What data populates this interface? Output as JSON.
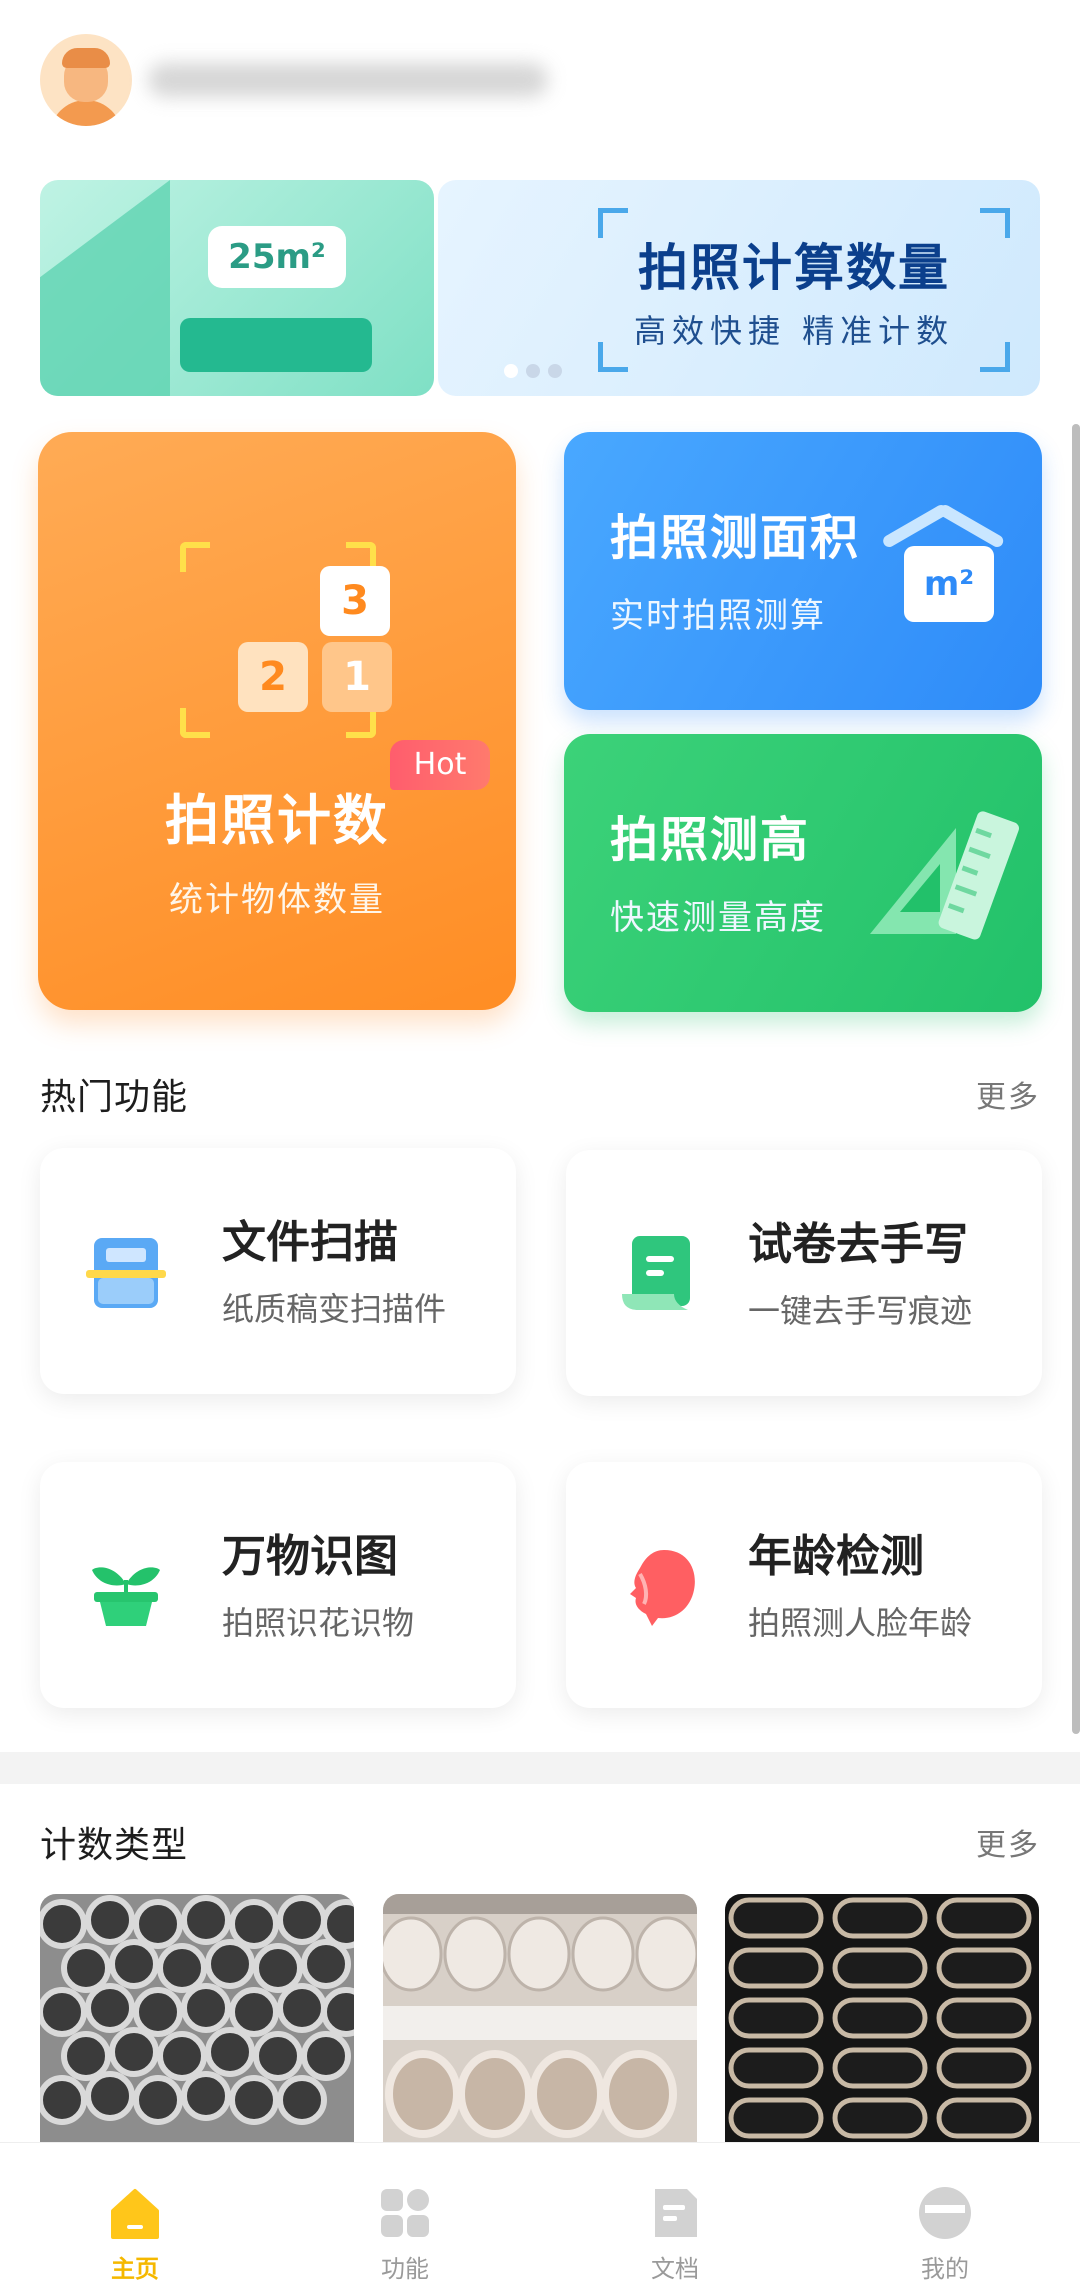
{
  "header": {
    "avatar": "user-avatar"
  },
  "banner": {
    "left_tag": "25m²",
    "title": "拍照计算数量",
    "subtitle": "高效快捷 精准计数",
    "dots": 3,
    "active_dot": 1
  },
  "features": {
    "count": {
      "title": "拍照计数",
      "subtitle": "统计物体数量",
      "badge": "Hot",
      "boxes": [
        "3",
        "2",
        "1"
      ]
    },
    "area": {
      "title": "拍照测面积",
      "subtitle": "实时拍照测算",
      "icon_text": "m²"
    },
    "height": {
      "title": "拍照测高",
      "subtitle": "快速测量高度"
    }
  },
  "hot_section": {
    "title": "热门功能",
    "more": "更多"
  },
  "tools": [
    {
      "name": "文件扫描",
      "desc": "纸质稿变扫描件",
      "icon": "scanner-icon"
    },
    {
      "name": "试卷去手写",
      "desc": "一键去手写痕迹",
      "icon": "paper-icon"
    },
    {
      "name": "万物识图",
      "desc": "拍照识花识物",
      "icon": "plant-icon"
    },
    {
      "name": "年龄检测",
      "desc": "拍照测人脸年龄",
      "icon": "face-icon"
    }
  ],
  "type_section": {
    "title": "计数类型",
    "more": "更多"
  },
  "types": [
    "steel-pipes-photo",
    "pvc-pipes-photo",
    "oval-tubes-photo"
  ],
  "nav": [
    {
      "label": "主页",
      "icon": "home-icon",
      "active": true
    },
    {
      "label": "功能",
      "icon": "apps-icon",
      "active": false
    },
    {
      "label": "文档",
      "icon": "document-icon",
      "active": false
    },
    {
      "label": "我的",
      "icon": "profile-icon",
      "active": false
    }
  ],
  "colors": {
    "accent": "#f5b800",
    "count_card": "#ff8d24",
    "area_card": "#2e8bf8",
    "height_card": "#22c16a",
    "hot_badge": "#ff5d6d"
  }
}
